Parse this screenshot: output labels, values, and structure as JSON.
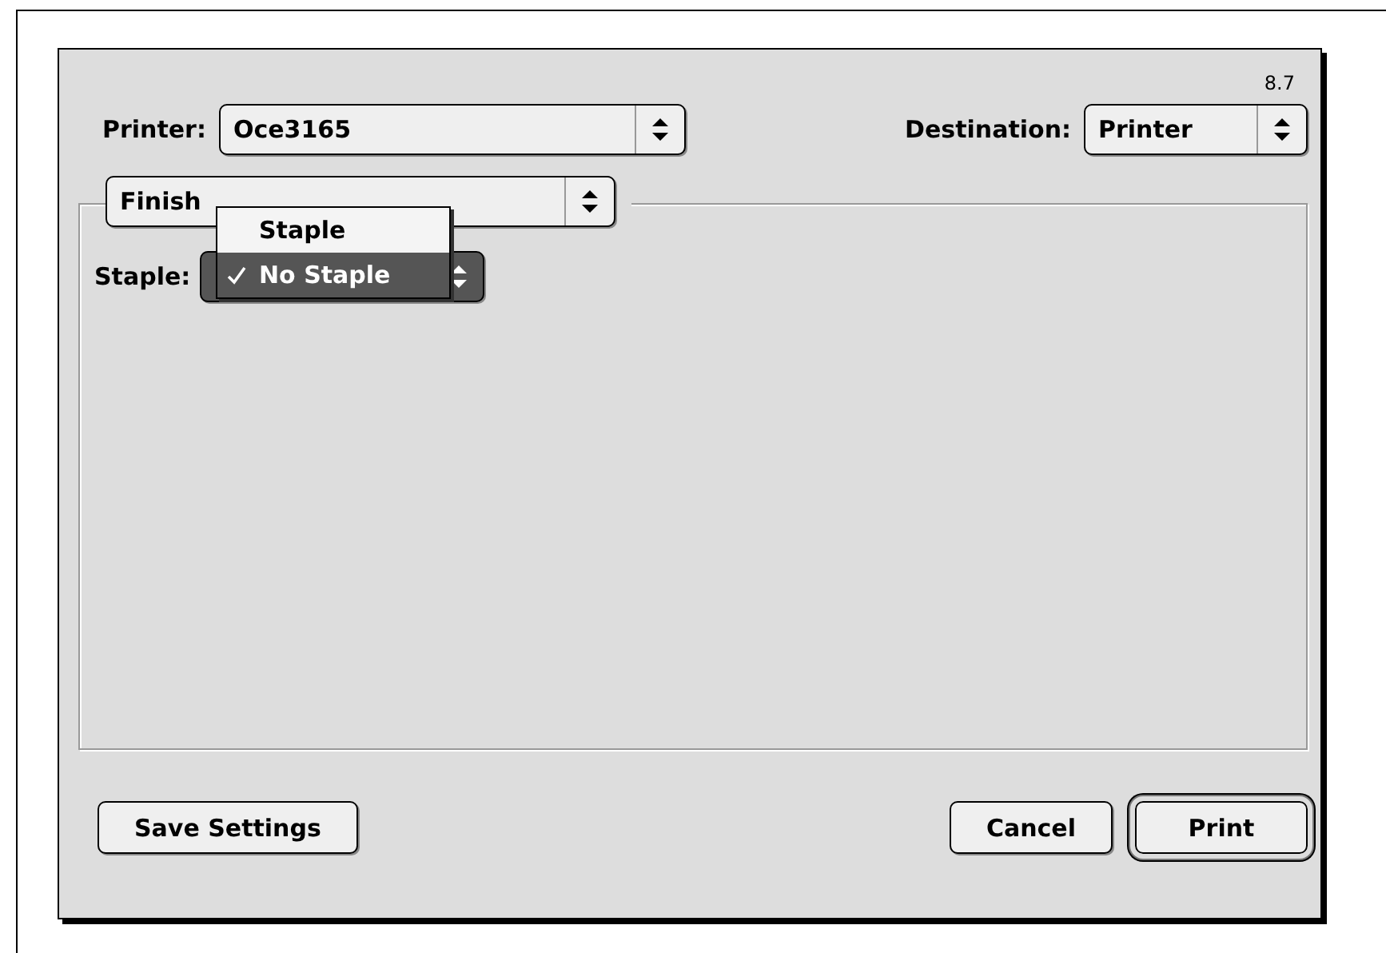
{
  "version": "8.7",
  "printer": {
    "label": "Printer:",
    "value": "Oce3165"
  },
  "destination": {
    "label": "Destination:",
    "value": "Printer"
  },
  "panel": {
    "value": "Finish"
  },
  "staple": {
    "label": "Staple:",
    "menu": [
      {
        "label": "Staple",
        "selected": false
      },
      {
        "label": "No Staple",
        "selected": true
      }
    ]
  },
  "left_buttons": [
    {
      "label": "Save Settings",
      "default": false
    }
  ],
  "right_buttons": [
    {
      "label": "Cancel",
      "default": false
    },
    {
      "label": "Print",
      "default": true
    }
  ]
}
